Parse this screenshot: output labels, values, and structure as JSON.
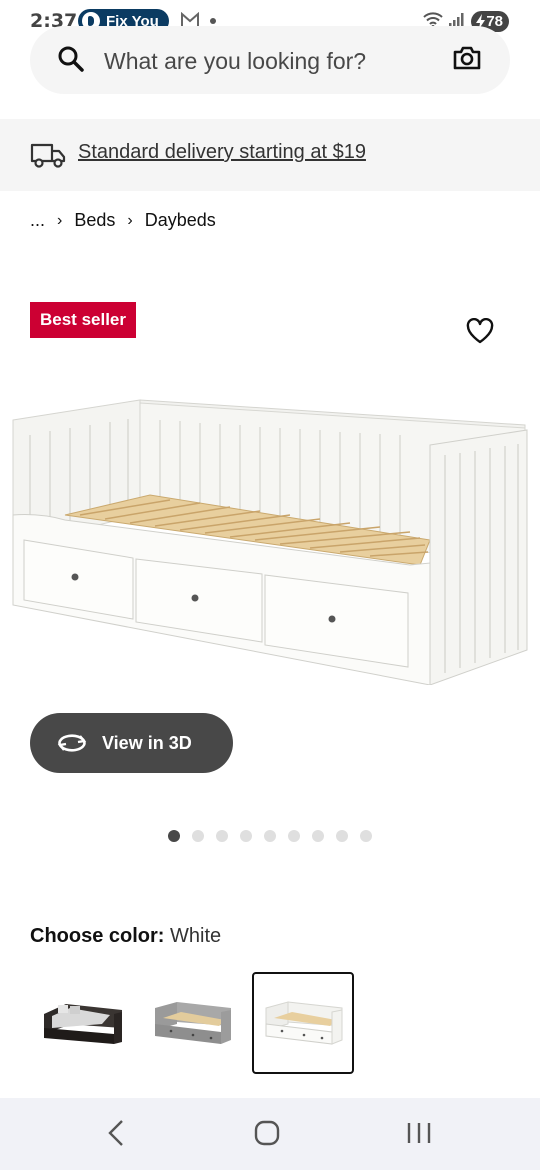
{
  "status": {
    "time": "2:37",
    "media_pill": "Fix You",
    "battery": "78"
  },
  "search": {
    "placeholder": "What are you looking for?"
  },
  "delivery": {
    "text": "Standard delivery starting at $19"
  },
  "breadcrumb": {
    "items": [
      "...",
      "Beds",
      "Daybeds"
    ]
  },
  "product": {
    "badge": "Best seller",
    "view3d_label": "View in 3D",
    "image_count": 9,
    "active_image": 1
  },
  "color": {
    "label": "Choose color:",
    "selected": "White",
    "options": [
      "Black-brown",
      "Gray",
      "White"
    ]
  },
  "colors": {
    "badge": "#cc0033",
    "button": "#484848",
    "pill": "#0b3b62"
  }
}
